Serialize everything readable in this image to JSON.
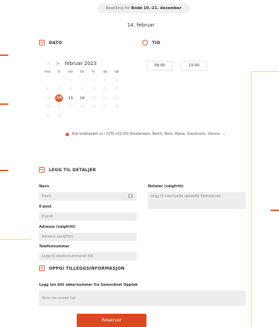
{
  "header": {
    "pill_prefix": "Bestilling for",
    "pill_bold": "Bodø 10.-21. desember",
    "selected_date": "14. februar"
  },
  "sections": {
    "date": "DATO",
    "time": "TID",
    "details": "LEGG TIL DETALJER",
    "extra": "OPPGI TILLEGGSINFORMASJON"
  },
  "calendar": {
    "month": "februar 2023",
    "prev_arrow": "<",
    "next_arrow": ">",
    "weekdays": [
      "ma",
      "ti",
      "on",
      "to",
      "fr",
      "lø",
      "sø"
    ],
    "weeks": [
      [
        "",
        "",
        "1",
        "2",
        "3",
        "4",
        "5"
      ],
      [
        "6",
        "7",
        "8",
        "9",
        "10",
        "11",
        "12"
      ],
      [
        "13",
        "14",
        "15",
        "16",
        "17",
        "18",
        "19"
      ],
      [
        "20",
        "21",
        "22",
        "23",
        "24",
        "25",
        "26"
      ],
      [
        "27",
        "28",
        "",
        "",
        "",
        "",
        ""
      ]
    ],
    "selected": "14",
    "available": [
      "15",
      "16"
    ]
  },
  "times": [
    "09:00",
    "13:00"
  ],
  "timezone": {
    "text": "Alle klokkeslett er i  (UTC+01:00) Amsterdam, Berlin, Bern, Rome, Stockholm, Vienna",
    "chevron": "⌄"
  },
  "form": {
    "name_label": "Navn",
    "name_placeholder": "Navn",
    "email_label": "E-post",
    "email_placeholder": "E-post",
    "address_label": "Adresse (valgfritt)",
    "address_placeholder": "Adresse (valgfritt)",
    "phone_label": "Telefonnummer",
    "phone_placeholder": "Legg til telefonnummeret ditt",
    "notes_label": "Notater (valgfritt)",
    "notes_placeholder": "Legg til eventuelle spesielle forespørsler",
    "extra_question": "Legg inn ditt søkernummer fra Samordnet Opptak",
    "extra_placeholder": "Skriv inn svaret her"
  },
  "reserve_label": "Reserver",
  "colors": {
    "accent": "#e4572e",
    "button": "#d94a1e"
  }
}
